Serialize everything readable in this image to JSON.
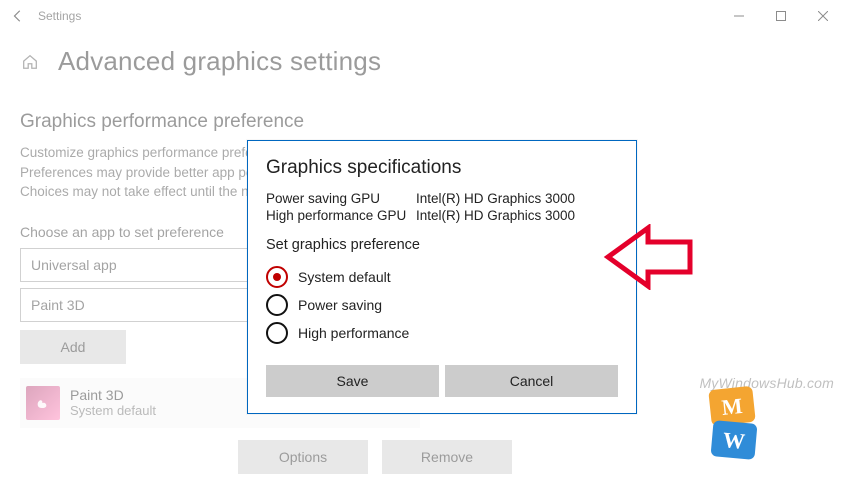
{
  "titlebar": {
    "app_name": "Settings"
  },
  "page": {
    "title": "Advanced graphics settings",
    "section_heading": "Graphics performance preference",
    "description": "Customize graphics performance preference for specific applications. Preferences may provide better app performance or save battery life. Choices may not take effect until the next time the app launches.",
    "choose_label": "Choose an app to set preference",
    "app_type_value": "Universal app",
    "app_pick_value": "Paint 3D",
    "add_label": "Add"
  },
  "list": {
    "items": [
      {
        "name": "Paint 3D",
        "pref": "System default"
      }
    ],
    "options_label": "Options",
    "remove_label": "Remove"
  },
  "dialog": {
    "title": "Graphics specifications",
    "rows": [
      {
        "k": "Power saving GPU",
        "v": "Intel(R) HD Graphics 3000"
      },
      {
        "k": "High performance GPU",
        "v": "Intel(R) HD Graphics 3000"
      }
    ],
    "subheading": "Set graphics preference",
    "radios": [
      {
        "label": "System default",
        "selected": true
      },
      {
        "label": "Power saving",
        "selected": false
      },
      {
        "label": "High performance",
        "selected": false
      }
    ],
    "save_label": "Save",
    "cancel_label": "Cancel"
  },
  "watermark": "MyWindowsHub.com"
}
